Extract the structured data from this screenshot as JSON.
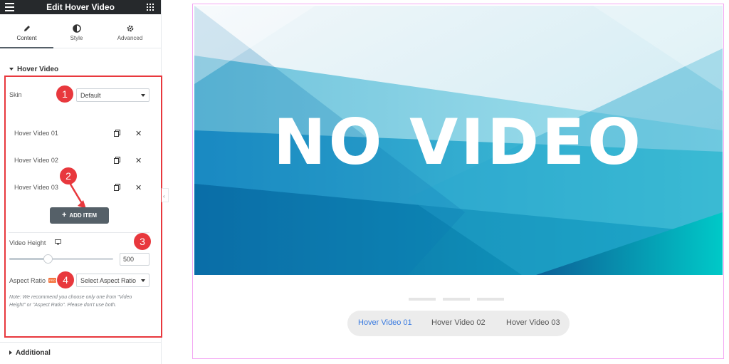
{
  "header": {
    "title": "Edit Hover Video"
  },
  "tabs": [
    {
      "label": "Content",
      "icon": "pencil-icon"
    },
    {
      "label": "Style",
      "icon": "half-circle-icon"
    },
    {
      "label": "Advanced",
      "icon": "gear-icon"
    }
  ],
  "section_main": {
    "label": "Hover Video"
  },
  "skin": {
    "label": "Skin",
    "value": "Default"
  },
  "items": [
    {
      "label": "Hover Video 01"
    },
    {
      "label": "Hover Video 02"
    },
    {
      "label": "Hover Video 03"
    }
  ],
  "add_item_label": "ADD ITEM",
  "video_height": {
    "label": "Video Height",
    "value": "500",
    "level_percent": 37
  },
  "aspect_ratio": {
    "label": "Aspect Ratio",
    "placeholder": "Select Aspect Ratio",
    "badge": "PRO"
  },
  "note": "Note: We recommend you choose only one from \"Video Height\" or \"Aspect Ratio\". Please don't use both.",
  "section_additional": {
    "label": "Additional"
  },
  "badges": [
    "1",
    "2",
    "3",
    "4"
  ],
  "preview": {
    "caption": "NO VIDEO",
    "tabs": [
      "Hover Video 01",
      "Hover Video 02",
      "Hover Video 03"
    ],
    "active_tab_index": 0
  },
  "colors": {
    "accent_red": "#e8383d",
    "active_tab_blue": "#3a7be0",
    "topbar": "#26292c"
  }
}
